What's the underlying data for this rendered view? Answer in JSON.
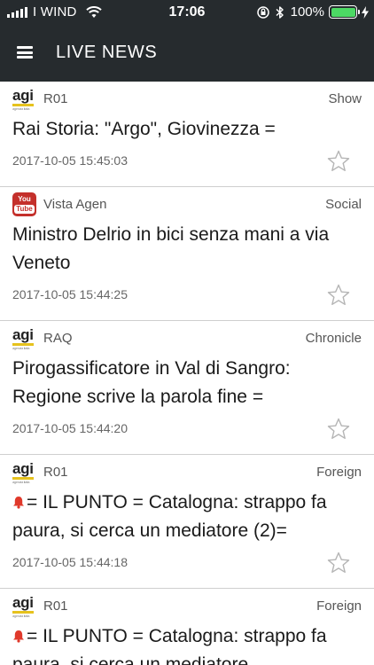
{
  "status_bar": {
    "carrier": "I WIND",
    "time": "17:06",
    "battery": "100%"
  },
  "header": {
    "title": "LIVE NEWS"
  },
  "news": [
    {
      "source": "R01",
      "logo": "agi-logo",
      "category": "Show",
      "title": "Rai Storia: \"Argo\", Giovinezza =",
      "alert": false,
      "timestamp": "2017-10-05 15:45:03"
    },
    {
      "source": "Vista Agen",
      "logo": "youtube-logo",
      "category": "Social",
      "title": "Ministro Delrio in bici senza mani a via Veneto",
      "alert": false,
      "timestamp": "2017-10-05 15:44:25"
    },
    {
      "source": "RAQ",
      "logo": "agi-logo",
      "category": "Chronicle",
      "title": "Pirogassificatore in Val di Sangro: Regione scrive la parola fine =",
      "alert": false,
      "timestamp": "2017-10-05 15:44:20"
    },
    {
      "source": "R01",
      "logo": "agi-logo",
      "category": "Foreign",
      "title": "= IL PUNTO = Catalogna: strappo fa paura, si cerca un mediatore (2)=",
      "alert": true,
      "timestamp": "2017-10-05 15:44:18"
    },
    {
      "source": "R01",
      "logo": "agi-logo",
      "category": "Foreign",
      "title": "= IL PUNTO = Catalogna: strappo fa paura, si cerca un mediatore",
      "alert": true,
      "timestamp": ""
    }
  ],
  "logos": {
    "agi_text": "agi",
    "agi_subtext": "agenzia italia",
    "youtube_you": "You",
    "youtube_tube": "Tube"
  },
  "colors": {
    "header_bg": "#262b2e",
    "battery_green": "#4cd964",
    "alert_red": "#e0392b",
    "agi_yellow": "#e6c21d",
    "youtube_red": "#c4302b"
  }
}
